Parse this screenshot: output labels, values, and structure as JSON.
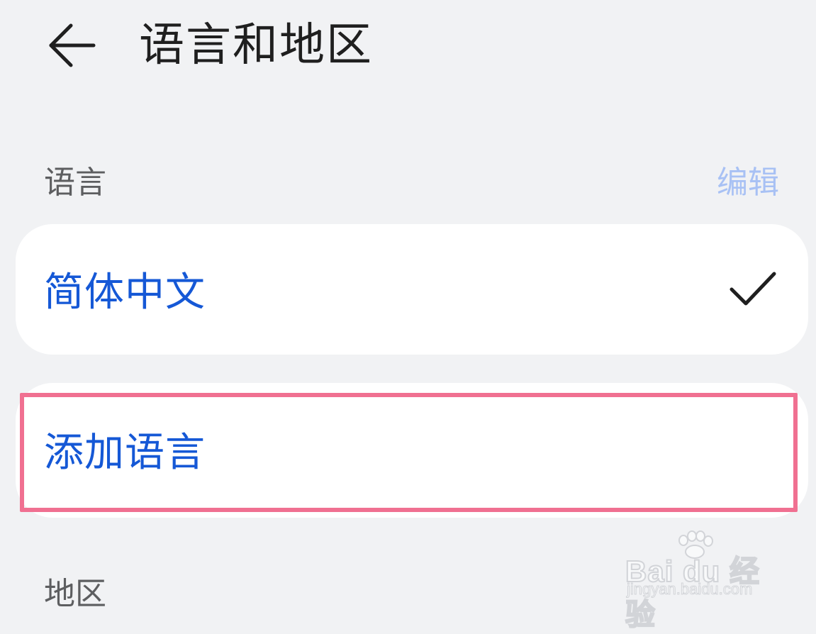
{
  "header": {
    "back_icon": "arrow-left-icon",
    "title": "语言和地区"
  },
  "language_section": {
    "label": "语言",
    "edit_label": "编辑",
    "edit_color": "#a8c1f4",
    "languages": [
      {
        "name": "简体中文",
        "selected": true,
        "check_icon": "checkmark-icon"
      }
    ],
    "add_language_label": "添加语言"
  },
  "region_section": {
    "label": "地区"
  },
  "highlight": {
    "target": "add-language",
    "color": "#f07091"
  },
  "watermark": {
    "brand": "Bai du 经验",
    "url": "jingyan.baidu.com"
  },
  "colors": {
    "background": "#f1f2f4",
    "card": "#ffffff",
    "accent": "#1558d6",
    "text_primary": "#1f1f1f",
    "text_secondary": "#5d5e60"
  }
}
